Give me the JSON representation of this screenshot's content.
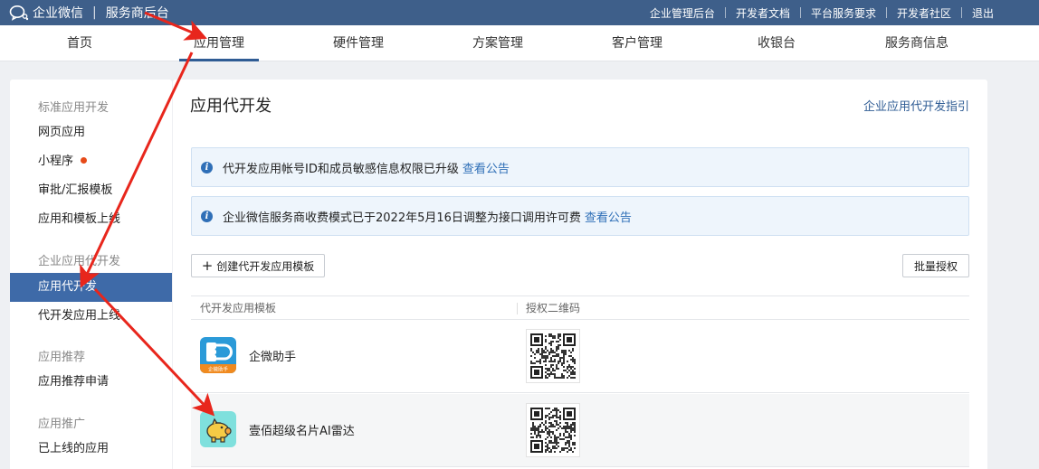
{
  "topbar": {
    "brand": "企业微信",
    "subtitle": "服务商后台",
    "links": [
      "企业管理后台",
      "开发者文档",
      "平台服务要求",
      "开发者社区",
      "退出"
    ]
  },
  "nav": {
    "items": [
      "首页",
      "应用管理",
      "硬件管理",
      "方案管理",
      "客户管理",
      "收银台",
      "服务商信息"
    ],
    "active": "应用管理"
  },
  "sidebar": {
    "groups": [
      {
        "title": "标准应用开发",
        "items": [
          "网页应用",
          "小程序",
          "审批/汇报模板",
          "应用和模板上线"
        ]
      },
      {
        "title": "企业应用代开发",
        "items": [
          "应用代开发",
          "代开发应用上线"
        ]
      },
      {
        "title": "应用推荐",
        "items": [
          "应用推荐申请"
        ]
      },
      {
        "title": "应用推广",
        "items": [
          "已上线的应用"
        ]
      }
    ],
    "active": "应用代开发"
  },
  "main": {
    "title": "应用代开发",
    "guide_link": "企业应用代开发指引",
    "notices": [
      {
        "text": "代开发应用帐号ID和成员敏感信息权限已升级",
        "link": "查看公告"
      },
      {
        "text": "企业微信服务商收费模式已于2022年5月16日调整为接口调用许可费",
        "link": "查看公告"
      }
    ],
    "create_button": "创建代开发应用模板",
    "batch_button": "批量授权",
    "table": {
      "columns": [
        "代开发应用模板",
        "授权二维码"
      ],
      "rows": [
        {
          "name": "企微助手",
          "icon": "qiwei-assistant-icon",
          "icon_caption": "企微助手"
        },
        {
          "name": "壹佰超级名片AI雷达",
          "icon": "piggy-bank-icon"
        }
      ]
    }
  },
  "colors": {
    "topbar": "#3e5f8a",
    "accent": "#2f5c94",
    "sidebar_active": "#3e6aa8",
    "notice_bg": "#eef5fc",
    "link": "#2f6fb7",
    "annotation_arrow": "#e8261c"
  }
}
